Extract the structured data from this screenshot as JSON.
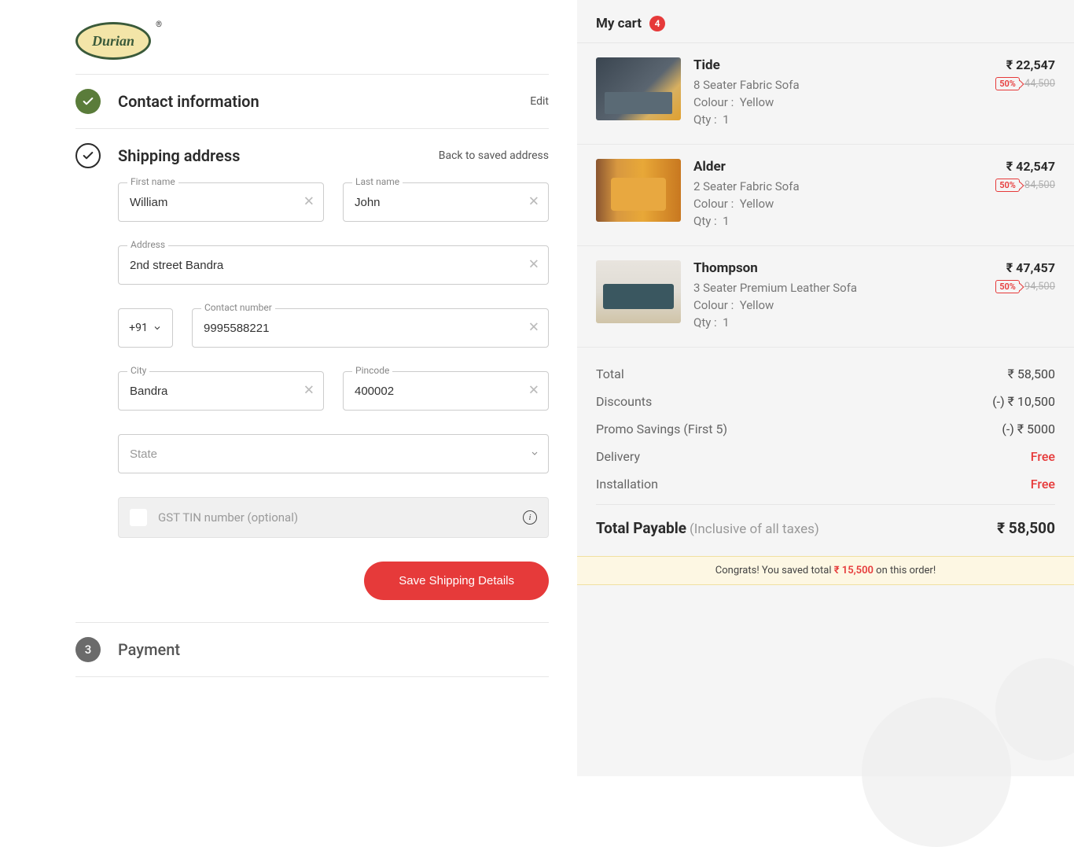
{
  "brand": {
    "name": "Durian",
    "reg": "®"
  },
  "steps": {
    "contact": {
      "title": "Contact information",
      "action": "Edit"
    },
    "shipping": {
      "title": "Shipping address",
      "action": "Back to saved address"
    },
    "payment": {
      "title": "Payment",
      "number": "3"
    }
  },
  "form": {
    "first_name": {
      "label": "First name",
      "value": "William"
    },
    "last_name": {
      "label": "Last name",
      "value": "John"
    },
    "address": {
      "label": "Address",
      "value": "2nd street Bandra"
    },
    "country_code": {
      "value": "+91"
    },
    "contact": {
      "label": "Contact number",
      "value": "9995588221"
    },
    "city": {
      "label": "City",
      "value": "Bandra"
    },
    "pincode": {
      "label": "Pincode",
      "value": "400002"
    },
    "state": {
      "placeholder": "State"
    },
    "gst": {
      "placeholder": "GST TIN number (optional)"
    },
    "save_label": "Save Shipping Details"
  },
  "cart": {
    "title": "My cart",
    "count": "4",
    "items": [
      {
        "name": "Tide",
        "desc": "8 Seater Fabric Sofa",
        "colour_label": "Colour :",
        "colour": "Yellow",
        "qty_label": "Qty :",
        "qty": "1",
        "price": "₹ 22,547",
        "discount": "50%",
        "old_price": "44,500"
      },
      {
        "name": "Alder",
        "desc": "2 Seater Fabric Sofa",
        "colour_label": "Colour :",
        "colour": "Yellow",
        "qty_label": "Qty :",
        "qty": "1",
        "price": "₹ 42,547",
        "discount": "50%",
        "old_price": "84,500"
      },
      {
        "name": "Thompson",
        "desc": "3 Seater Premium Leather Sofa",
        "colour_label": "Colour :",
        "colour": "Yellow",
        "qty_label": "Qty :",
        "qty": "1",
        "price": "₹ 47,457",
        "discount": "50%",
        "old_price": "94,500"
      }
    ],
    "totals": {
      "total_label": "Total",
      "total": "₹ 58,500",
      "discounts_label": "Discounts",
      "discounts": "(-) ₹ 10,500",
      "promo_label": "Promo Savings (First 5)",
      "promo": "(-) ₹ 5000",
      "delivery_label": "Delivery",
      "delivery": "Free",
      "install_label": "Installation",
      "install": "Free",
      "payable_label": "Total Payable",
      "payable_sub": "(Inclusive of all taxes)",
      "payable": "₹ 58,500"
    },
    "congrats": {
      "pre": "Congrats! You saved total ",
      "amount": "₹ 15,500",
      "post": " on this order!"
    }
  }
}
